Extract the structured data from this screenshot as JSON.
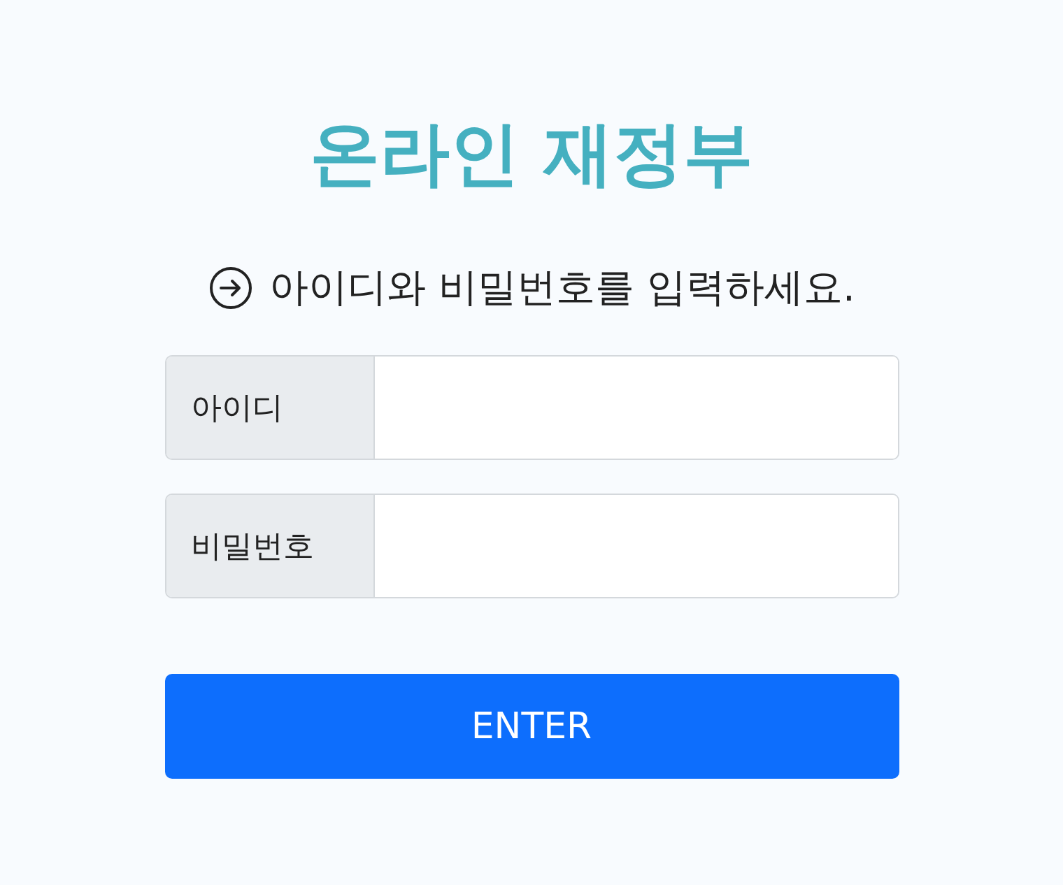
{
  "title": "온라인 재정부",
  "instruction": "아이디와 비밀번호를 입력하세요.",
  "fields": [
    {
      "label": "아이디"
    },
    {
      "label": "비밀번호"
    }
  ],
  "button": "ENTER"
}
